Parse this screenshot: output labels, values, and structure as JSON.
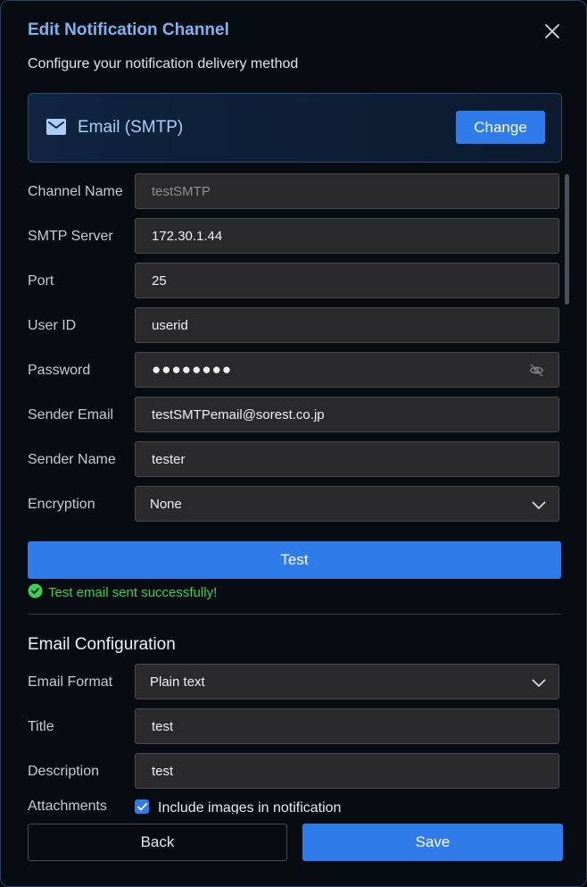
{
  "dialog": {
    "title": "Edit Notification Channel",
    "subtitle": "Configure your notification delivery method",
    "close_icon": "close-icon"
  },
  "channel_type": {
    "icon": "mail-icon",
    "label": "Email (SMTP)",
    "change_label": "Change"
  },
  "form": {
    "channel_name": {
      "label": "Channel Name",
      "value": "testSMTP"
    },
    "smtp_server": {
      "label": "SMTP Server",
      "value": "172.30.1.44"
    },
    "port": {
      "label": "Port",
      "value": "25"
    },
    "user_id": {
      "label": "User ID",
      "value": "userid"
    },
    "password": {
      "label": "Password",
      "value": "●●●●●●●●",
      "toggle_icon": "eye-off-icon"
    },
    "sender_email": {
      "label": "Sender Email",
      "value": "testSMTPemail@sorest.co.jp"
    },
    "sender_name": {
      "label": "Sender Name",
      "value": "tester"
    },
    "encryption": {
      "label": "Encryption",
      "value": "None"
    }
  },
  "test": {
    "button_label": "Test",
    "status_icon": "check-circle-icon",
    "status_text": "Test email sent successfully!"
  },
  "email_config": {
    "heading": "Email Configuration",
    "format": {
      "label": "Email Format",
      "value": "Plain text"
    },
    "title": {
      "label": "Title",
      "value": "test"
    },
    "description": {
      "label": "Description",
      "value": "test"
    },
    "attachments": {
      "label": "Attachments",
      "checkbox_label": "Include images in notification",
      "checked": true
    }
  },
  "footer": {
    "back_label": "Back",
    "save_label": "Save"
  },
  "colors": {
    "accent": "#2f7bea",
    "title": "#7fb3f0",
    "success": "#3ccf59"
  }
}
